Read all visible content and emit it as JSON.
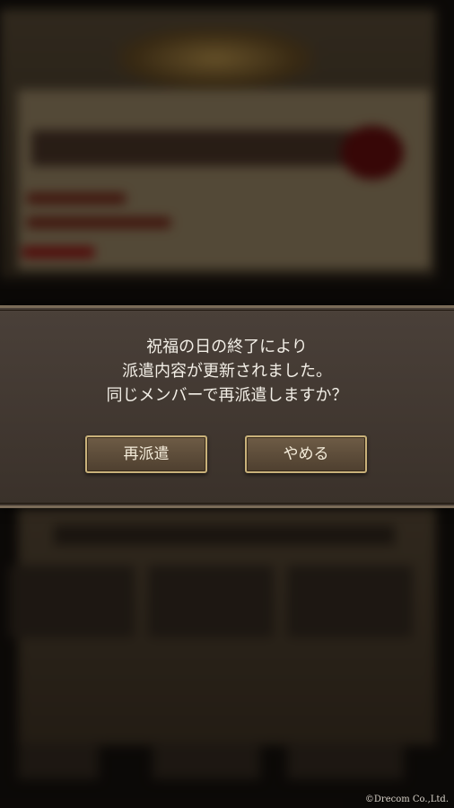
{
  "dialog": {
    "message_lines": [
      "祝福の日の終了により",
      "派遣内容が更新されました。",
      "同じメンバーで再派遣しますか？"
    ],
    "redispatch_label": "再派遣",
    "cancel_label": "やめる"
  },
  "footer": {
    "copyright": "©Drecom Co.,Ltd."
  }
}
